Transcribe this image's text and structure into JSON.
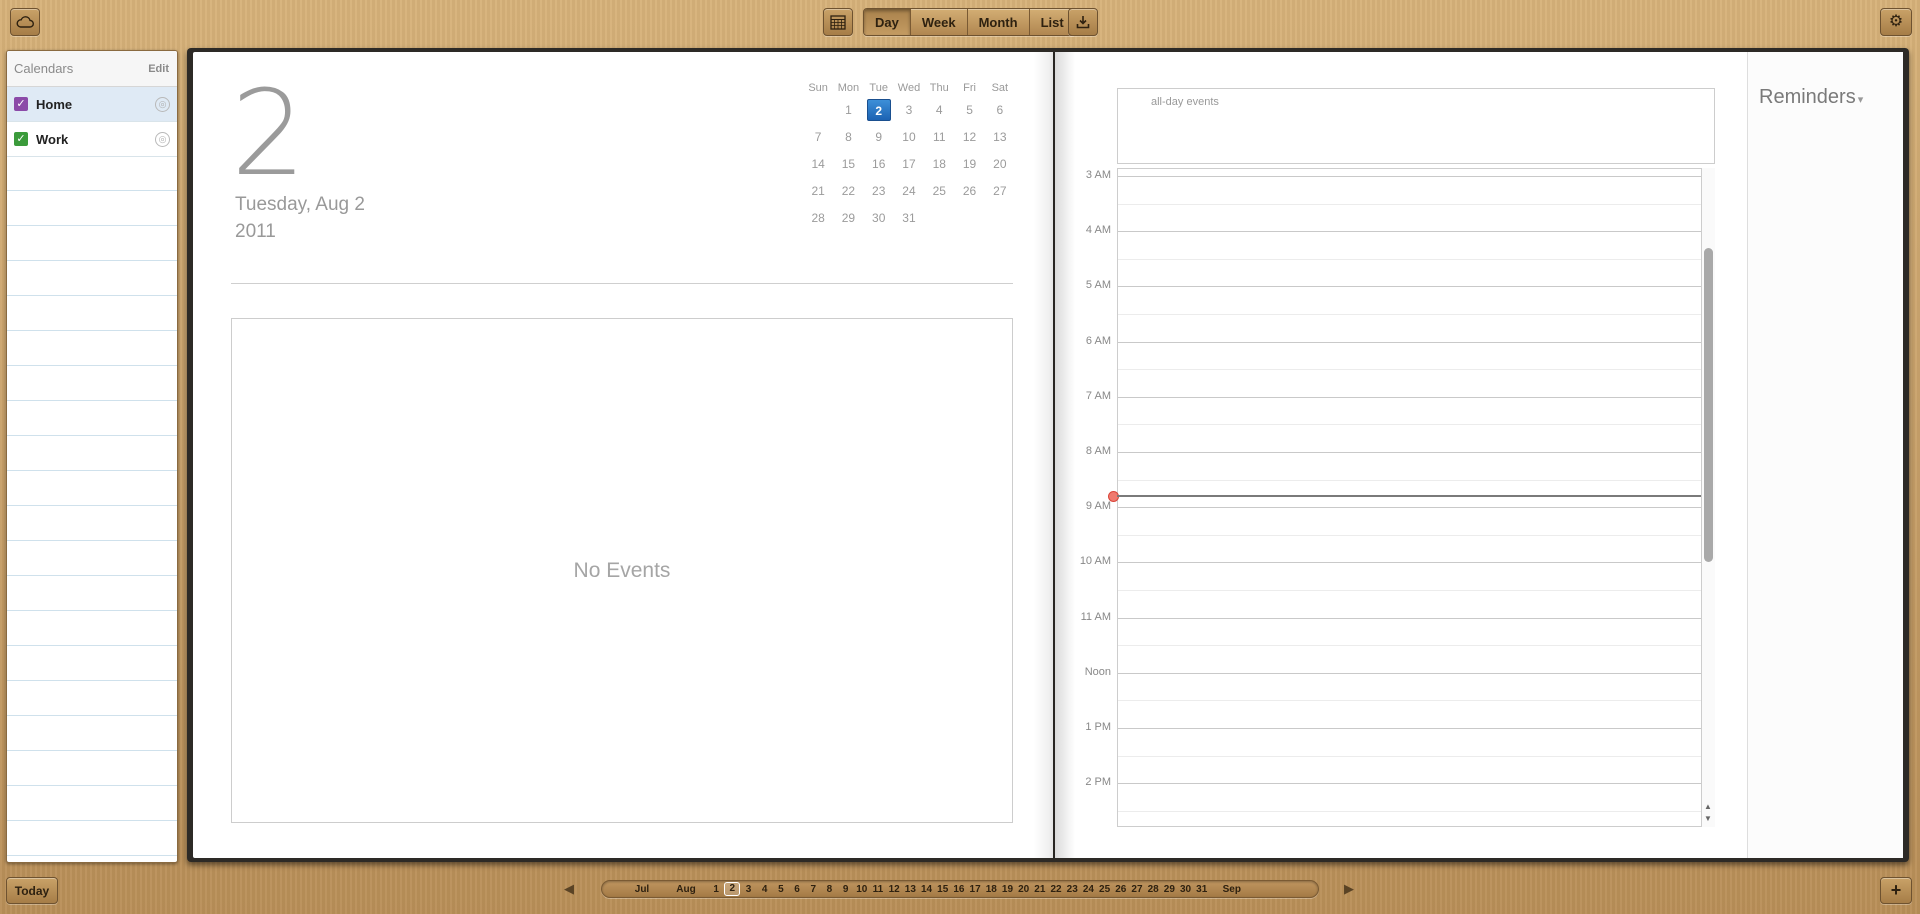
{
  "toolbar": {
    "view_tabs": [
      {
        "label": "Day",
        "active": true
      },
      {
        "label": "Week",
        "active": false
      },
      {
        "label": "Month",
        "active": false
      },
      {
        "label": "List",
        "active": false
      }
    ]
  },
  "sidebar": {
    "title": "Calendars",
    "edit_label": "Edit",
    "calendars": [
      {
        "name": "Home",
        "color": "#8b4aa8",
        "checked": true,
        "selected": true
      },
      {
        "name": "Work",
        "color": "#3b9b3b",
        "checked": true,
        "selected": false
      }
    ]
  },
  "day_view": {
    "day_number": "2",
    "date_text": "Tuesday, Aug 2",
    "year_text": "2011",
    "empty_message": "No Events"
  },
  "mini_calendar": {
    "weekdays": [
      "Sun",
      "Mon",
      "Tue",
      "Wed",
      "Thu",
      "Fri",
      "Sat"
    ],
    "weeks": [
      [
        "",
        "1",
        "2",
        "3",
        "4",
        "5",
        "6"
      ],
      [
        "7",
        "8",
        "9",
        "10",
        "11",
        "12",
        "13"
      ],
      [
        "14",
        "15",
        "16",
        "17",
        "18",
        "19",
        "20"
      ],
      [
        "21",
        "22",
        "23",
        "24",
        "25",
        "26",
        "27"
      ],
      [
        "28",
        "29",
        "30",
        "31",
        "",
        "",
        ""
      ]
    ],
    "today": "2"
  },
  "timeline": {
    "allday_label": "all-day events",
    "hours": [
      "3 AM",
      "4 AM",
      "5 AM",
      "6 AM",
      "7 AM",
      "8 AM",
      "9 AM",
      "10 AM",
      "11 AM",
      "Noon",
      "1 PM",
      "2 PM"
    ]
  },
  "reminders": {
    "title": "Reminders"
  },
  "bottom": {
    "today_label": "Today",
    "strip": [
      {
        "t": "Jul",
        "kind": "mon"
      },
      {
        "t": "Aug",
        "kind": "mon"
      },
      {
        "t": "1",
        "kind": "d"
      },
      {
        "t": "2",
        "kind": "d",
        "selected": true
      },
      {
        "t": "3",
        "kind": "d"
      },
      {
        "t": "4",
        "kind": "d"
      },
      {
        "t": "5",
        "kind": "d"
      },
      {
        "t": "6",
        "kind": "d"
      },
      {
        "t": "7",
        "kind": "d"
      },
      {
        "t": "8",
        "kind": "d"
      },
      {
        "t": "9",
        "kind": "d"
      },
      {
        "t": "10",
        "kind": "d"
      },
      {
        "t": "11",
        "kind": "d"
      },
      {
        "t": "12",
        "kind": "d"
      },
      {
        "t": "13",
        "kind": "d"
      },
      {
        "t": "14",
        "kind": "d"
      },
      {
        "t": "15",
        "kind": "d"
      },
      {
        "t": "16",
        "kind": "d"
      },
      {
        "t": "17",
        "kind": "d"
      },
      {
        "t": "18",
        "kind": "d"
      },
      {
        "t": "19",
        "kind": "d"
      },
      {
        "t": "20",
        "kind": "d"
      },
      {
        "t": "21",
        "kind": "d"
      },
      {
        "t": "22",
        "kind": "d"
      },
      {
        "t": "23",
        "kind": "d"
      },
      {
        "t": "24",
        "kind": "d"
      },
      {
        "t": "25",
        "kind": "d"
      },
      {
        "t": "26",
        "kind": "d"
      },
      {
        "t": "27",
        "kind": "d"
      },
      {
        "t": "28",
        "kind": "d"
      },
      {
        "t": "29",
        "kind": "d"
      },
      {
        "t": "30",
        "kind": "d"
      },
      {
        "t": "31",
        "kind": "d"
      },
      {
        "t": "Sep",
        "kind": "mon"
      }
    ]
  }
}
